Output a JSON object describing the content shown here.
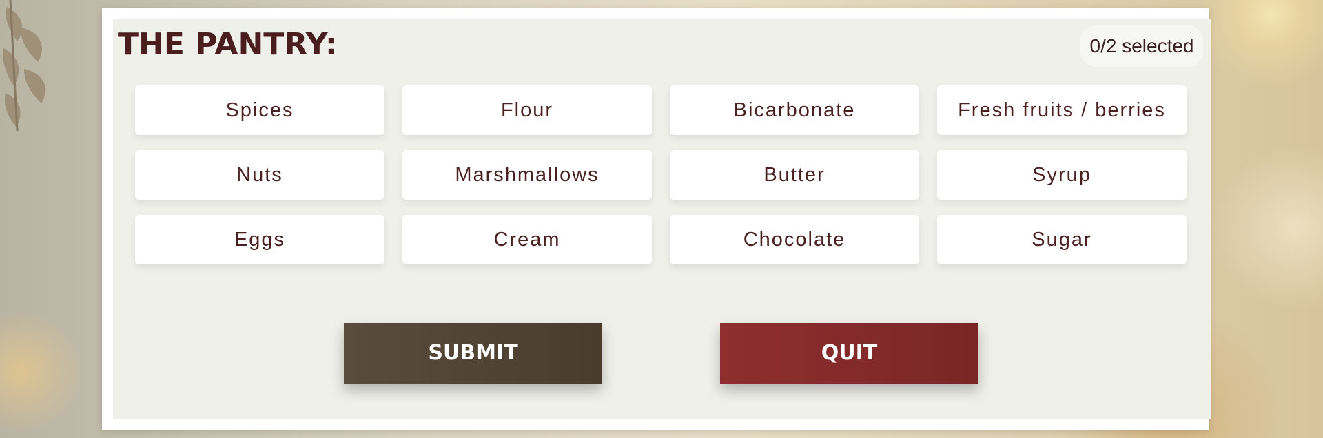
{
  "pantry": {
    "title": "THE PANTRY:",
    "selection_counter": "0/2 selected",
    "ingredients": [
      "Spices",
      "Flour",
      "Bicarbonate",
      "Fresh fruits / berries",
      "Nuts",
      "Marshmallows",
      "Butter",
      "Syrup",
      "Eggs",
      "Cream",
      "Chocolate",
      "Sugar"
    ]
  },
  "actions": {
    "submit_label": "SUBMIT",
    "quit_label": "QUIT"
  },
  "colors": {
    "title_text": "#4a1e1e",
    "submit_bg": "#4f4232",
    "quit_bg": "#862a2a",
    "panel_bg": "#f0f0ea"
  }
}
